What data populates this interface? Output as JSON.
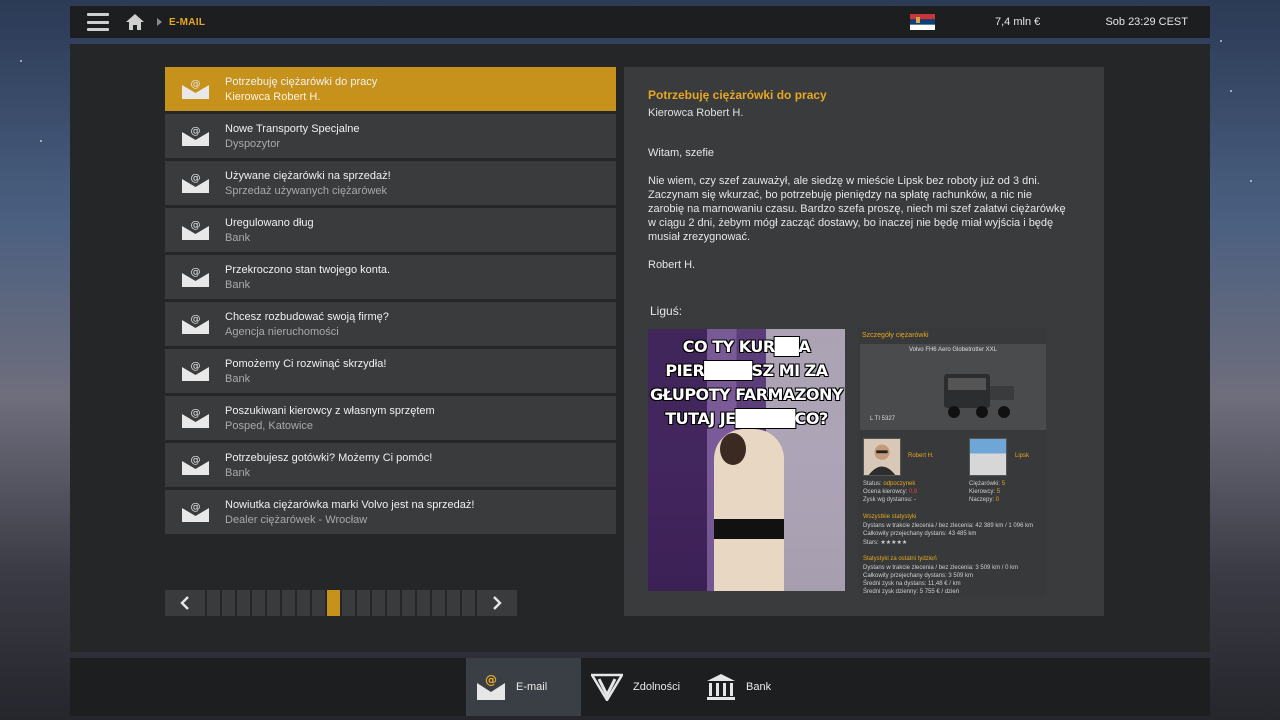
{
  "topbar": {
    "breadcrumb": "E-MAIL",
    "money": "7,4 mln  €",
    "clock": "Sob 23:29 CEST"
  },
  "colors": {
    "accent": "#c7921c",
    "accent_text": "#e6a722",
    "panel": "#252628",
    "row": "#3a3b3d"
  },
  "emails": [
    {
      "subject": "Potrzebuję ciężarówki do pracy",
      "from": "Kierowca Robert H."
    },
    {
      "subject": "Nowe Transporty Specjalne",
      "from": "Dyspozytor"
    },
    {
      "subject": "Używane ciężarówki na sprzedaż!",
      "from": "Sprzedaż używanych ciężarówek"
    },
    {
      "subject": "Uregulowano dług",
      "from": "Bank"
    },
    {
      "subject": "Przekroczono stan twojego konta.",
      "from": "Bank"
    },
    {
      "subject": "Chcesz rozbudować swoją firmę?",
      "from": "Agencja nieruchomości"
    },
    {
      "subject": "Pomożemy Ci rozwinąć skrzydła!",
      "from": "Bank"
    },
    {
      "subject": "Poszukiwani kierowcy z własnym sprzętem",
      "from": "Posped, Katowice"
    },
    {
      "subject": "Potrzebujesz gotówki? Możemy Ci pomóc!",
      "from": "Bank"
    },
    {
      "subject": "Nowiutka ciężarówka marki Volvo jest na sprzedaż!",
      "from": "Dealer ciężarówek - Wrocław"
    }
  ],
  "pager": {
    "page_count": 18,
    "current_page": 9
  },
  "reader": {
    "title": "Potrzebuję ciężarówki do pracy",
    "from": "Kierowca Robert H.",
    "greeting": "Witam, szefie",
    "body": "Nie wiem, czy szef zauważył, ale siedzę w mieście Lipsk bez roboty już od 3 dni. Zaczynam się wkurzać, bo potrzebuję pieniędzy na spłatę rachunków, a nic nie zarobię na marnowaniu czasu. Bardzo szefa proszę, niech mi szef załatwi ciężarówkę w ciągu 2 dni, żebym mógł zacząć dostawy, bo inaczej nie będę miał wyjścia i będę musiał zrezygnować.",
    "signature": "Robert H.",
    "attachment_label": "Liguś:"
  },
  "meme": {
    "lines": [
      "CO TY KUR██A",
      "PIER████SZ MI ZA",
      "GŁUPOTY FARMAZONY",
      "TUTAJ JE█████CO?"
    ]
  },
  "details": {
    "header": "Szczegóły ciężarówki",
    "truck_name": "Volvo FH6 Aero Globetrotter XXL",
    "plate": "L TI 5327",
    "driver_name": "Robert H.",
    "garage_name": "Lipsk",
    "status_label": "Status:",
    "status_value": "odpoczynek",
    "rating_label": "Ocena kierowcy:",
    "rating_value": "0,8",
    "profit_label": "Zysk wg dystansu:",
    "profit_value": "-",
    "trucks_label": "Ciężarówki:",
    "trucks_value": "5",
    "drivers_label": "Kierowcy:",
    "drivers_value": "5",
    "trailers_label": "Naczepy:",
    "trailers_value": "0",
    "all_stats_header": "Wszystkie statystyki",
    "all_distance": "Dystans w trakcie zlecenia / bez zlecenia:  42 389 km / 1 096 km",
    "all_total": "Całkowity przejechany dystans:  43 485 km",
    "all_stars": "Stars: ★★★★★",
    "week_stats_header": "Statystyki za ostatni tydzień",
    "week_distance": "Dystans w trakcie zlecenia / bez zlecenia:  3 509 km / 0 km",
    "week_total": "Całkowity przejechany dystans:  3 509 km",
    "week_avg_km": "Średni zysk na dystans:  11,48 € / km",
    "week_avg_day": "Średni zysk dzienny:  5 755 € / dzień"
  },
  "bottom_tabs": [
    {
      "label": "E-mail"
    },
    {
      "label": "Zdolności"
    },
    {
      "label": "Bank"
    }
  ]
}
